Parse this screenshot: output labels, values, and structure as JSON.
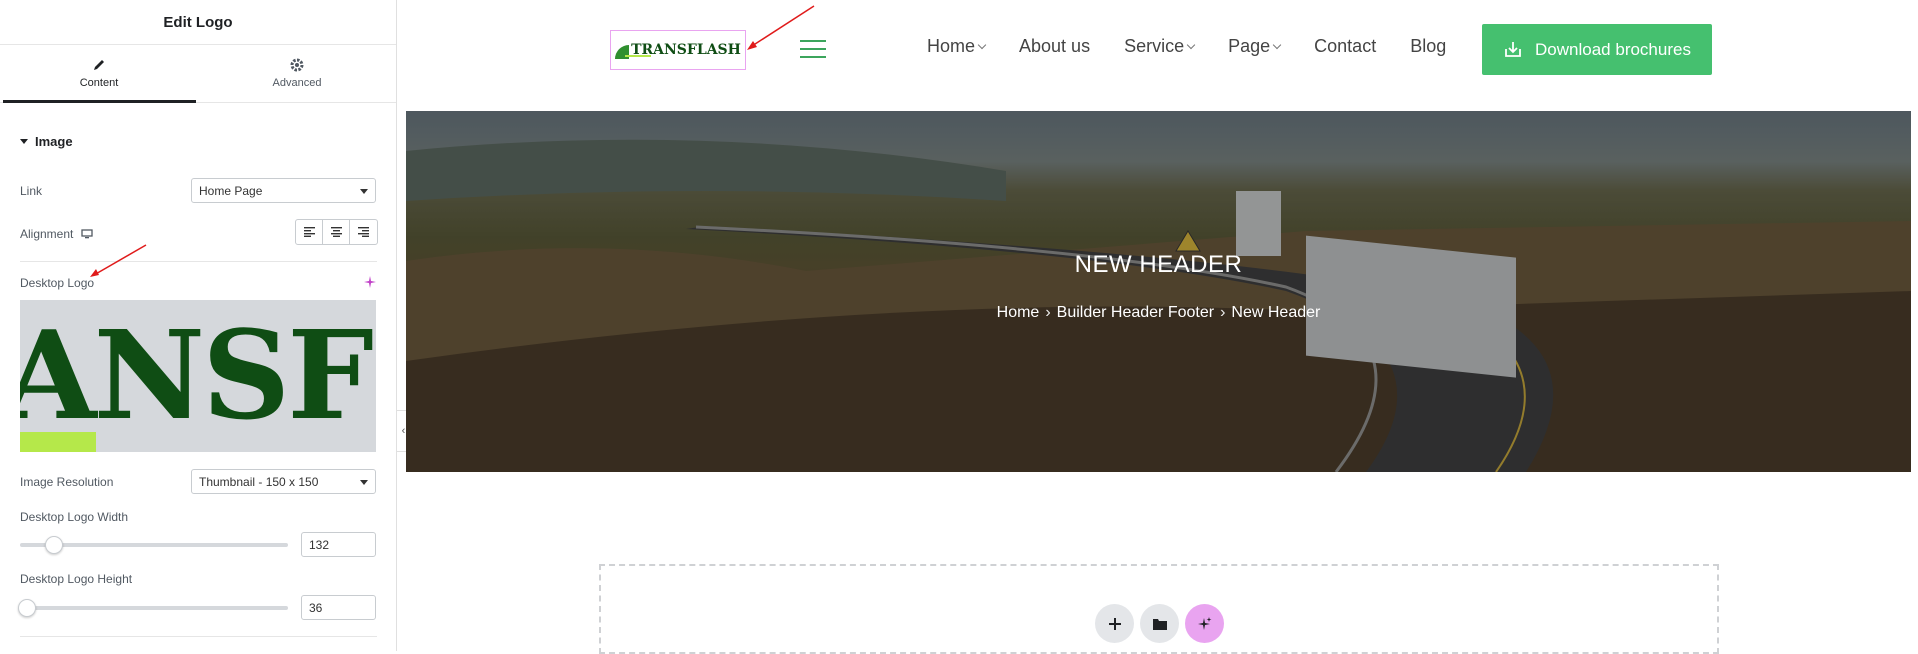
{
  "panel": {
    "title": "Edit Logo",
    "tabs": [
      {
        "label": "Content",
        "icon": "pencil-icon"
      },
      {
        "label": "Advanced",
        "icon": "gear-icon"
      }
    ],
    "section": "Image",
    "link_label": "Link",
    "link_value": "Home Page",
    "alignment_label": "Alignment",
    "desktop_logo_label": "Desktop Logo",
    "logo_preview_text": "ANSFI",
    "image_resolution_label": "Image Resolution",
    "image_resolution_value": "Thumbnail - 150 x 150",
    "logo_width_label": "Desktop Logo Width",
    "logo_width_value": "132",
    "logo_height_label": "Desktop Logo Height",
    "logo_height_value": "36"
  },
  "site": {
    "logo_text": "TRANSFLASH",
    "nav": [
      {
        "label": "Home",
        "dropdown": true
      },
      {
        "label": "About us",
        "dropdown": false
      },
      {
        "label": "Service",
        "dropdown": true
      },
      {
        "label": "Page",
        "dropdown": true
      },
      {
        "label": "Contact",
        "dropdown": false
      },
      {
        "label": "Blog",
        "dropdown": false
      }
    ],
    "cta_label": "Download brochures",
    "hero_title": "NEW HEADER",
    "breadcrumb": [
      "Home",
      "Builder Header Footer",
      "New Header"
    ]
  },
  "colors": {
    "accent": "#45c06f",
    "logo_green": "#0f4d14",
    "lime": "#b5e84a",
    "ai_pink": "#e9a4f0"
  }
}
